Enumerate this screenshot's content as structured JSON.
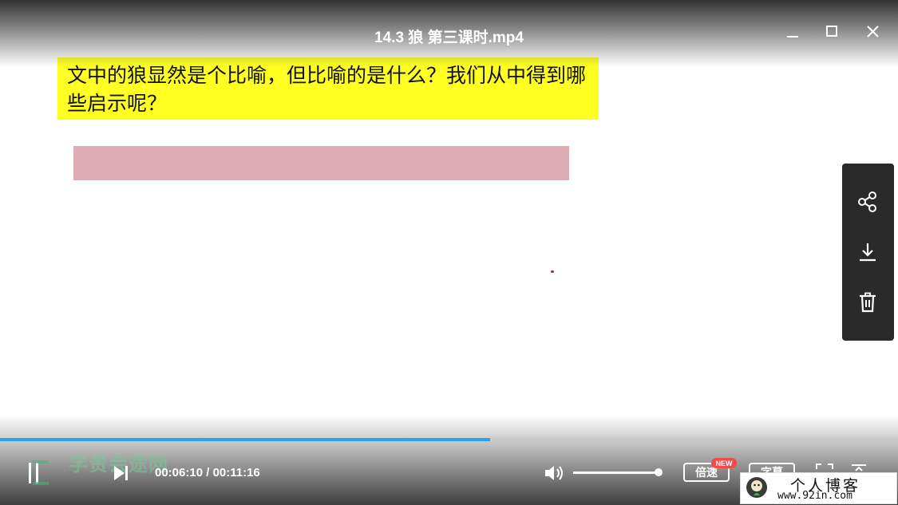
{
  "window": {
    "title": "14.3 狼 第三课时.mp4",
    "minimize_icon": "minimize-icon",
    "maximize_icon": "maximize-icon",
    "close_icon": "close-icon"
  },
  "video": {
    "question_text": "文中的狼显然是个比喻，但比喻的是什么？我们从中得到哪些启示呢？",
    "question_bg_color": "#ffff22",
    "answer_bar_color": "#ddacb4"
  },
  "side_panel": {
    "items": [
      {
        "icon": "share-icon"
      },
      {
        "icon": "download-icon"
      },
      {
        "icon": "trash-icon"
      }
    ]
  },
  "player": {
    "progress_fraction": 0.546,
    "progress_color": "#2aa3f5",
    "current_time": "00:06:10",
    "separator": " / ",
    "total_time": "00:11:16",
    "watermark_text": "学贵会途网",
    "volume_fraction": 1.0,
    "speed_label": "倍速",
    "speed_badge": "NEW",
    "subtitle_label": "字幕",
    "icons": [
      "pause-icon",
      "next-icon",
      "volume-icon",
      "fullscreen-icon",
      "exit-icon"
    ]
  },
  "blog_watermark": {
    "name": "个人博客",
    "url": "www.92in.com"
  }
}
